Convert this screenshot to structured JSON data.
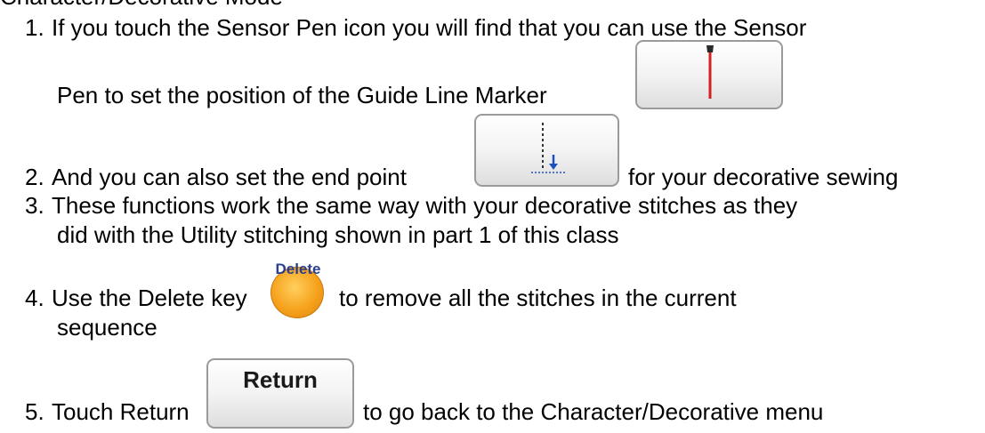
{
  "page": {
    "heading_fragment": "Character/Decorative Mode",
    "items": [
      {
        "num": "1.",
        "text_a": "If you touch the Sensor Pen icon you will find that you can use the Sensor",
        "text_b": "Pen to set the position of the Guide Line Marker"
      },
      {
        "num": "2.",
        "text_a": "And you can also set the end point",
        "text_b": "for your decorative sewing"
      },
      {
        "num": "3.",
        "text_a": "These functions work the same way with your decorative stitches as they",
        "text_b": "did with the Utility stitching shown in part 1 of this class"
      },
      {
        "num": "4.",
        "text_a": "Use the Delete key",
        "text_b": "to remove all the stitches in the current",
        "text_c": "sequence"
      },
      {
        "num": "5.",
        "text_a": "Touch Return",
        "text_b": "to go back to the Character/Decorative menu"
      }
    ]
  },
  "icons": {
    "sensor_pen": "sensor-pen-guide-line-marker-icon",
    "end_point": "end-point-icon",
    "delete": {
      "label": "Delete",
      "color": "#f6a21c"
    },
    "return": {
      "label": "Return"
    }
  },
  "colors": {
    "marker_red": "#d42020",
    "endpoint_blue": "#1f4fbf",
    "button_border": "#9a9a9a"
  }
}
